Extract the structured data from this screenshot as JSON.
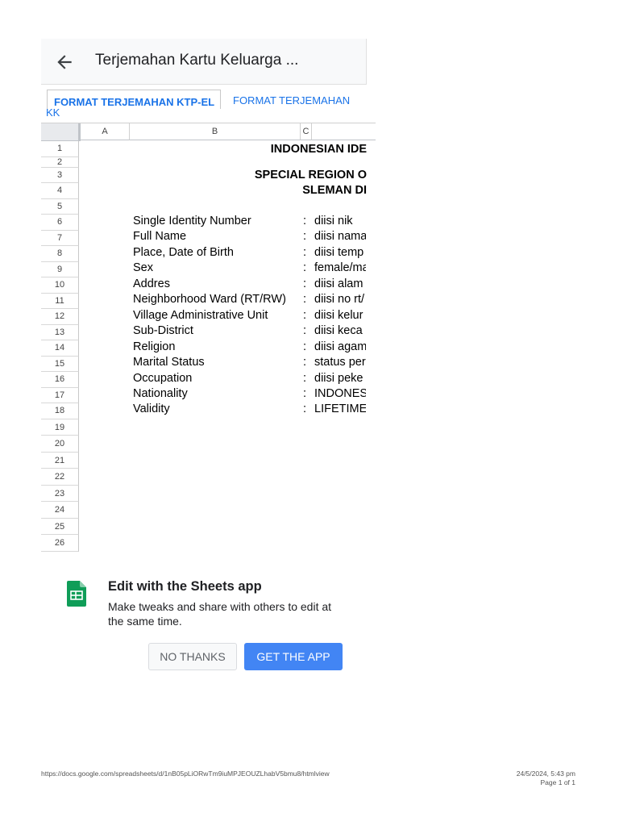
{
  "header": {
    "title": "Terjemahan Kartu Keluarga ..."
  },
  "tabs": {
    "active_label": "FORMAT TERJEMAHAN KTP-EL",
    "inactive_label": "FORMAT TERJEMAHAN KK"
  },
  "grid": {
    "columns": [
      "A",
      "B",
      "C"
    ],
    "row_numbers": [
      "1",
      "2",
      "3",
      "4",
      "5",
      "6",
      "7",
      "8",
      "9",
      "10",
      "11",
      "12",
      "13",
      "14",
      "15",
      "16",
      "17",
      "18",
      "19",
      "20",
      "21",
      "22",
      "23",
      "24",
      "25",
      "26"
    ],
    "heading_1": "INDONESIAN IDE",
    "heading_3": "SPECIAL REGION O",
    "heading_4": "SLEMAN DI",
    "fields": [
      {
        "label": "Single Identity Number",
        "sep": ":",
        "value": "diisi nik"
      },
      {
        "label": "Full Name",
        "sep": ":",
        "value": "diisi nama"
      },
      {
        "label": "Place, Date of Birth",
        "sep": ":",
        "value": "diisi temp"
      },
      {
        "label": "Sex",
        "sep": ":",
        "value": "female/ma"
      },
      {
        "label": "Addres",
        "sep": ":",
        "value": "diisi alam"
      },
      {
        "label": "Neighborhood Ward (RT/RW)",
        "sep": ":",
        "value": "diisi no rt/"
      },
      {
        "label": "Village Administrative Unit",
        "sep": ":",
        "value": "diisi kelur"
      },
      {
        "label": "Sub-District",
        "sep": ":",
        "value": "diisi keca"
      },
      {
        "label": "Religion",
        "sep": ":",
        "value": "diisi agam"
      },
      {
        "label": "Marital Status",
        "sep": ":",
        "value": "status per"
      },
      {
        "label": "Occupation",
        "sep": ":",
        "value": "diisi peke"
      },
      {
        "label": "Nationality",
        "sep": ":",
        "value": "INDONES"
      },
      {
        "label": "Validity",
        "sep": ":",
        "value": "LIFETIME"
      }
    ]
  },
  "promo": {
    "title": "Edit with the Sheets app",
    "description": "Make tweaks and share with others to edit at the same time.",
    "no_thanks": "NO THANKS",
    "get_app": "GET THE APP",
    "icon": "google-sheets-icon"
  },
  "footer": {
    "url": "https://docs.google.com/spreadsheets/d/1nB05pLiORwTm9iuMPJEOUZLhabV5bmu8/htmlview",
    "date": "24/5/2024, 5:43 pm",
    "page": "Page 1 of 1"
  },
  "colors": {
    "accent": "#1a73e8",
    "button_primary": "#4285f4",
    "sheets_green": "#0f9d58"
  }
}
